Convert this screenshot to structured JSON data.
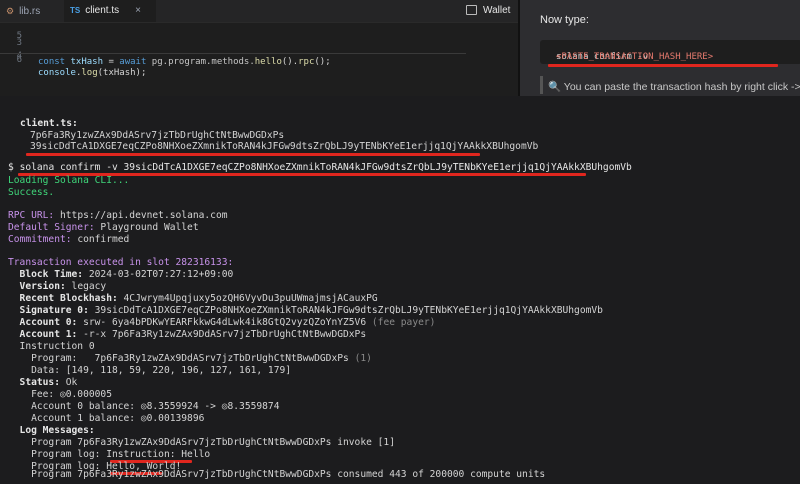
{
  "editor": {
    "tabs": [
      {
        "icon": "rust-icon",
        "icon_text": "",
        "label": "lib.rs",
        "active": false
      },
      {
        "icon": "typescript-icon",
        "icon_text": "TS",
        "label": "client.ts",
        "active": true
      }
    ],
    "tab_close": "×",
    "wallet_label": "Wallet",
    "lines": [
      {
        "num": "3",
        "text": ""
      },
      {
        "num": "4",
        "text": ""
      },
      {
        "num": "5",
        "kw": "const",
        "var": " txHash",
        "rest1": " = ",
        "kw2": "await",
        "rest2": " pg.program.methods.",
        "fn": "hello",
        "rest3": "().",
        "fn2": "rpc",
        "rest4": "();"
      },
      {
        "num": "6",
        "var": "console",
        "rest1": ".",
        "fn": "log",
        "rest2": "(txHash);"
      }
    ]
  },
  "tutorial": {
    "now_type": "Now type:",
    "command_prefix": "solana confirm -v ",
    "command_placeholder": "<PASTE_TRANSACTION_HASH_HERE>",
    "hint": "🔍 You can paste the transaction hash by right click -> Pa"
  },
  "terminal": {
    "client_label": "client.ts:",
    "program_id_line": "7p6Fa3Ry1zwZAx9DdASrv7jzTbDrUghCtNtBwwDGDxPs",
    "tx_hash_line": "39sicDdTcA1DXGE7eqCZPo8NHXoeZXmnikToRAN4kJFGw9dtsZrQbLJ9yTENbKYeE1erjjq1QjYAAkkXBUhgomVb",
    "prompt": "$ ",
    "command": "solana confirm -v 39sicDdTcA1DXGE7eqCZPo8NHXoeZXmnikToRAN4kJFGw9dtsZrQbLJ9yTENbKYeE1erjjq1QjYAAkkXBUhgomVb",
    "loading": "Loading Solana CLI...",
    "success": "Success.",
    "rpc_label": "RPC URL:",
    "rpc_value": " https://api.devnet.solana.com",
    "signer_label": "Default Signer:",
    "signer_value": " Playground Wallet",
    "commitment_label": "Commitment:",
    "commitment_value": " confirmed",
    "executed": "Transaction executed in slot 282316133:",
    "block_time_label": "  Block Time:",
    "block_time_value": " 2024-03-02T07:27:12+09:00",
    "version_label": "  Version:",
    "version_value": " legacy",
    "blockhash_label": "  Recent Blockhash:",
    "blockhash_value": " 4CJwrym4Upqjuxy5ozQH6VyvDu3puUWmajmsjACauxPG",
    "sig_label": "  Signature 0:",
    "sig_value": " 39sicDdTcA1DXGE7eqCZPo8NHXoeZXmnikToRAN4kJFGw9dtsZrQbLJ9yTENbKYeE1erjjq1QjYAAkkXBUhgomVb",
    "acc0_label": "  Account 0:",
    "acc0_value": " srw- 6ya4bPDKwYEARFkkwG4dLwk4ik8GtQ2vyzQZoYnYZ5V6 ",
    "acc0_note": "(fee payer)",
    "acc1_label": "  Account 1:",
    "acc1_value": " -r-x 7p6Fa3Ry1zwZAx9DdASrv7jzTbDrUghCtNtBwwDGDxPs",
    "instr0": "  Instruction 0",
    "program_line": "    Program:   7p6Fa3Ry1zwZAx9DdASrv7jzTbDrUghCtNtBwwDGDxPs ",
    "program_note": "(1)",
    "data_line": "    Data: [149, 118, 59, 220, 196, 127, 161, 179]",
    "status_label": "  Status:",
    "status_value": " Ok",
    "fee_line": "    Fee: ◎0.000005",
    "acc0_balance": "    Account 0 balance: ◎8.3559924 -> ◎8.3559874",
    "acc1_balance": "    Account 1 balance: ◎0.00139896",
    "log_label": "  Log Messages:",
    "log1": "    Program 7p6Fa3Ry1zwZAx9DdASrv7jzTbDrUghCtNtBwwDGDxPs invoke [1]",
    "log2": "    Program log: Instruction: Hello",
    "log3": "    Program log: Hello, World!",
    "log4": "    Program 7p6Fa3Ry1zwZAx9DdASrv7jzTbDrUghCtNtBwwDGDxPs consumed 443 of 200000 compute units"
  }
}
